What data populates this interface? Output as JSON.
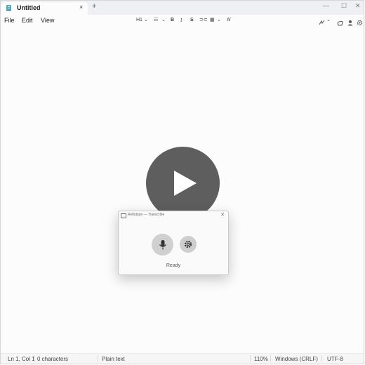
{
  "tab": {
    "title": "Untitled",
    "close": "×",
    "new": "+"
  },
  "window_controls": {
    "minimize": "—",
    "maximize": "☐",
    "close": "✕"
  },
  "menu": {
    "file": "File",
    "edit": "Edit",
    "view": "View"
  },
  "toolbar": {
    "heading": "H1",
    "chev": "⌄",
    "list": "☷",
    "bold": "B",
    "italic": "I",
    "strike": "S",
    "link": "⊃⊂",
    "table": "▦",
    "clear": "A̸"
  },
  "dialog": {
    "title": "Reltutype — Transcribe",
    "close": "✕",
    "status": "Ready"
  },
  "status": {
    "position": "Ln 1, Col 1",
    "characters": "0 characters",
    "format": "Plain text",
    "zoom": "110%",
    "line_endings": "Windows (CRLF)",
    "encoding": "UTF-8"
  },
  "colors": {
    "tab_icon": "#5aa7b5",
    "play_overlay": "#484848",
    "accent": "#1c1c1c"
  }
}
